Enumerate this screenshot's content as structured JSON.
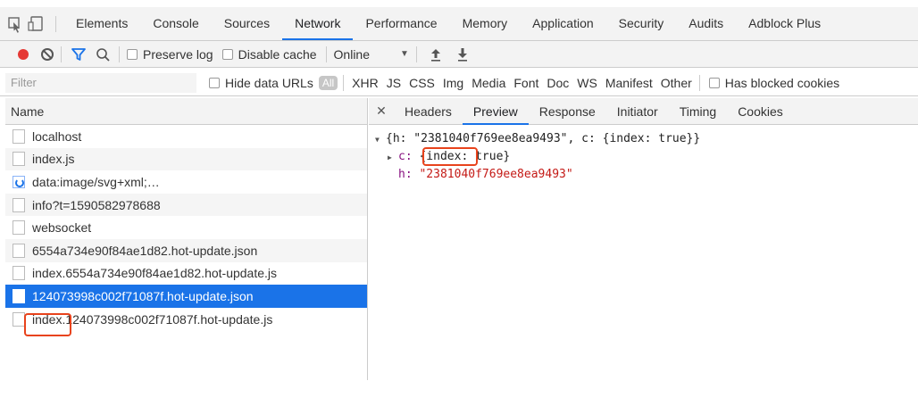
{
  "main_tabs": [
    "Elements",
    "Console",
    "Sources",
    "Network",
    "Performance",
    "Memory",
    "Application",
    "Security",
    "Audits",
    "Adblock Plus"
  ],
  "active_main_tab": "Network",
  "toolbar": {
    "preserve_log": "Preserve log",
    "disable_cache": "Disable cache",
    "throttling": "Online"
  },
  "filter": {
    "placeholder": "Filter",
    "hide_data_urls": "Hide data URLs",
    "all": "All",
    "types": [
      "XHR",
      "JS",
      "CSS",
      "Img",
      "Media",
      "Font",
      "Doc",
      "WS",
      "Manifest",
      "Other"
    ],
    "has_blocked_cookies": "Has blocked cookies"
  },
  "name_panel": {
    "header": "Name",
    "rows": [
      "localhost",
      "index.js",
      "data:image/svg+xml;…",
      "info?t=1590582978688",
      "websocket",
      "6554a734e90f84ae1d82.hot-update.json",
      "index.6554a734e90f84ae1d82.hot-update.js",
      "124073998c002f71087f.hot-update.json",
      "index.124073998c002f71087f.hot-update.js"
    ],
    "selected_index": 7
  },
  "detail_tabs": [
    "Headers",
    "Preview",
    "Response",
    "Initiator",
    "Timing",
    "Cookies"
  ],
  "active_detail_tab": "Preview",
  "preview": {
    "line1": "{h: \"2381040f769ee8ea9493\", c: {index: true}}",
    "c_key": "c:",
    "c_value": "{index: true}",
    "h_key": "h:",
    "h_value": "\"2381040f769ee8ea9493\""
  },
  "colors": {
    "accent": "#1a73e8",
    "highlight": "#e8431c",
    "record": "#e53935"
  }
}
